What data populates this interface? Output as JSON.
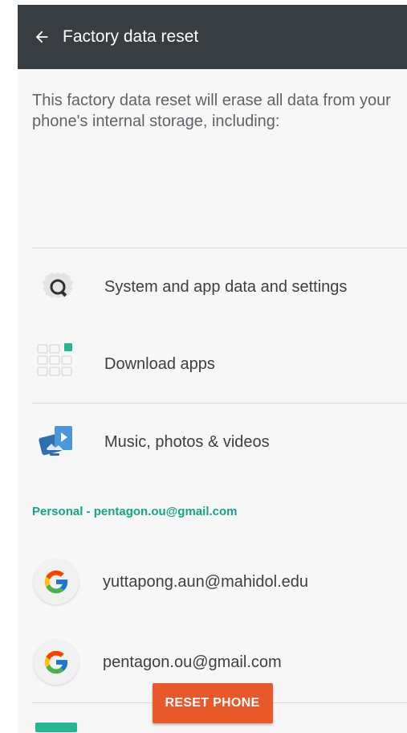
{
  "app_bar": {
    "title": "Factory data reset",
    "back_icon": "arrow-left-icon",
    "background": "#383d42"
  },
  "intro_text": "This factory data reset will erase all data from your phone's internal storage, including:",
  "items": [
    {
      "label": "System and app data and settings",
      "icon": "settings-gear-icon"
    },
    {
      "label": "Download apps",
      "icon": "app-grid-icon"
    },
    {
      "label": "Music, photos & videos",
      "icon": "media-icon"
    }
  ],
  "personal_section": {
    "header": "Personal - pentagon.ou@gmail.com",
    "accent": "#12a58a",
    "accounts": [
      {
        "email": "yuttapong.aun@mahidol.edu",
        "icon": "google-g-icon"
      },
      {
        "email": "pentagon.ou@gmail.com",
        "icon": "google-g-icon"
      }
    ]
  },
  "reset_button": {
    "label": "RESET PHONE",
    "color": "#e8582a"
  }
}
